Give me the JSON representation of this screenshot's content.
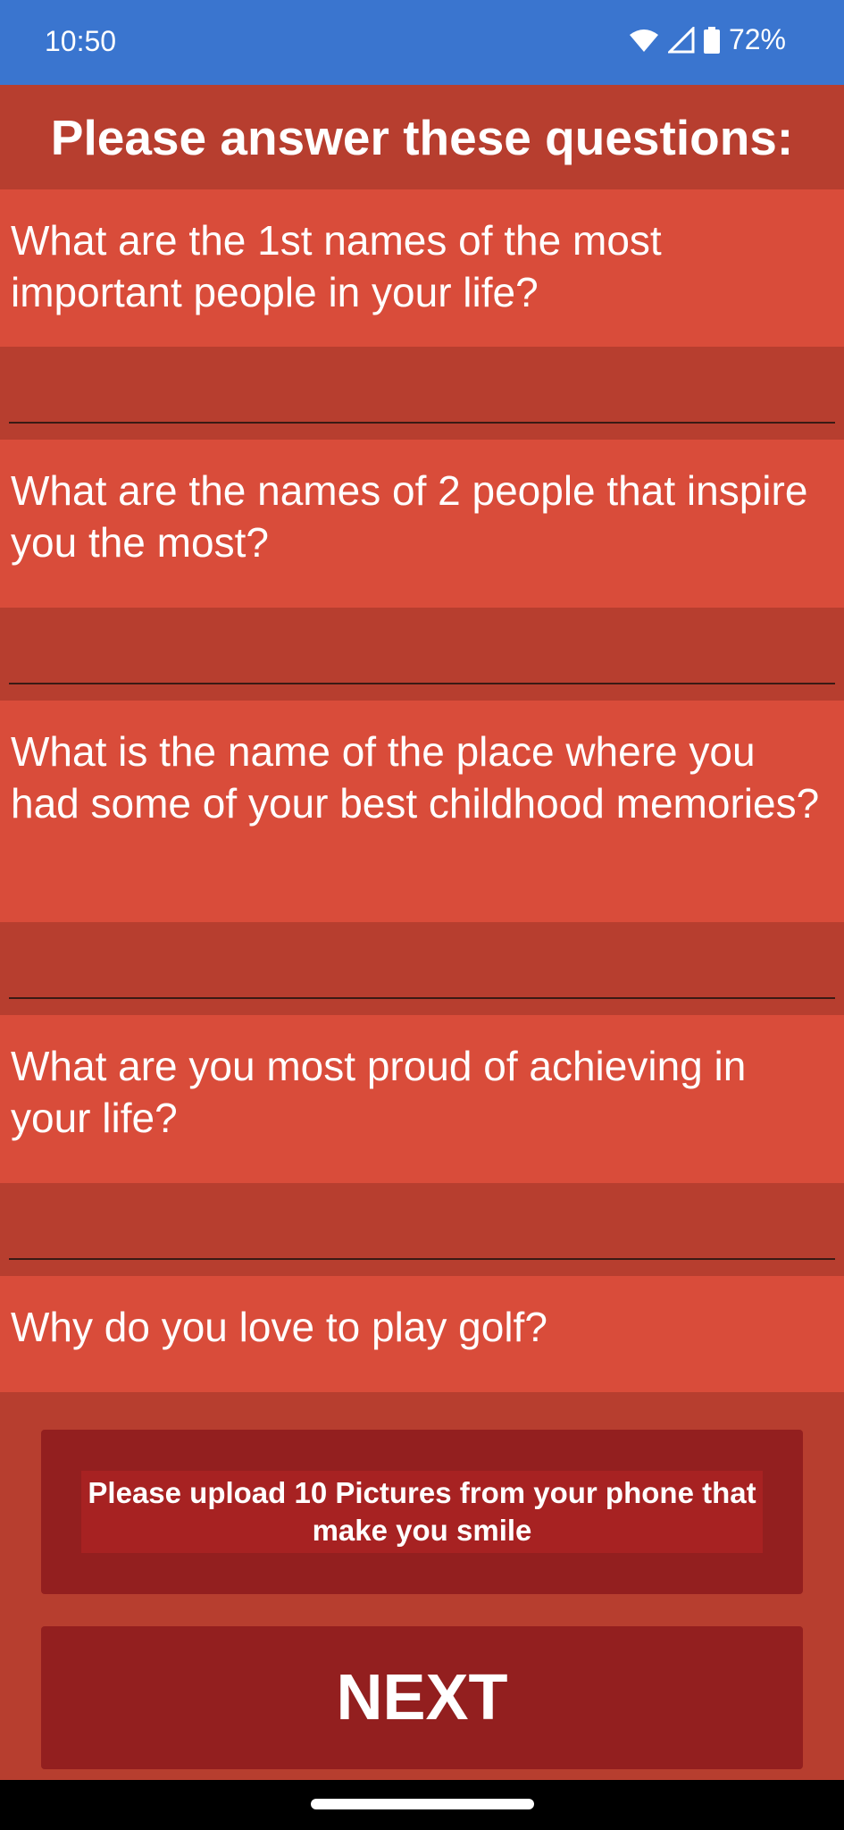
{
  "status_bar": {
    "time": "10:50",
    "battery": "72%",
    "icons": [
      "wifi-icon",
      "signal-icon",
      "battery-icon"
    ]
  },
  "header": {
    "title": "Please answer these questions:"
  },
  "questions": [
    {
      "text": "What are the 1st names of the most important people in your life?",
      "answer": ""
    },
    {
      "text": "What are the names of 2 people that inspire you the most?",
      "answer": ""
    },
    {
      "text": "What is the name of the place where you had some of your best childhood memories?",
      "answer": ""
    },
    {
      "text": "What are you most proud of achieving in your life?",
      "answer": ""
    },
    {
      "text": "Why do you love to play golf?",
      "answer": ""
    }
  ],
  "upload": {
    "label": "Please upload 10 Pictures from your phone that make you smile"
  },
  "next_button": {
    "label": "NEXT"
  },
  "colors": {
    "status_bar": "#3a75cf",
    "background": "#b73e2f",
    "question_bg": "#d94c3a",
    "button_bg": "#931f1f"
  }
}
